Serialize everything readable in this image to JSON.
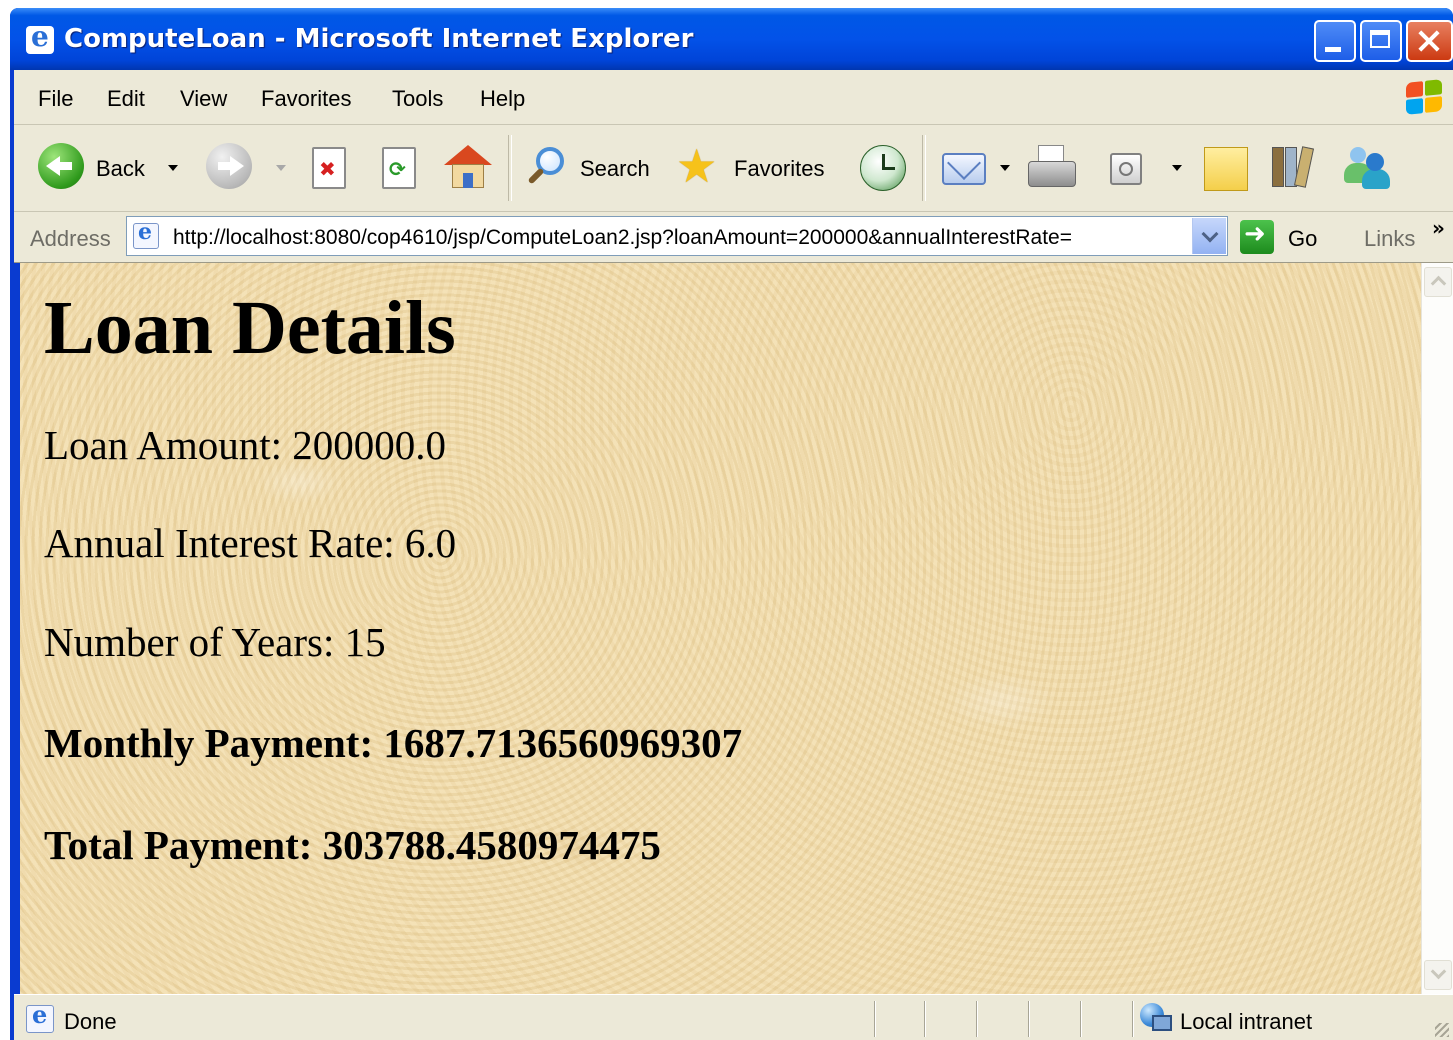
{
  "window": {
    "title": "ComputeLoan - Microsoft Internet Explorer"
  },
  "menu": {
    "file": "File",
    "edit": "Edit",
    "view": "View",
    "favorites": "Favorites",
    "tools": "Tools",
    "help": "Help"
  },
  "toolbar": {
    "back_label": "Back",
    "search_label": "Search",
    "favorites_label": "Favorites"
  },
  "address": {
    "label": "Address",
    "url": "http://localhost:8080/cop4610/jsp/ComputeLoan2.jsp?loanAmount=200000&annualInterestRate=",
    "go_label": "Go",
    "links_label": "Links",
    "overflow": "»"
  },
  "page": {
    "heading": "Loan Details",
    "loan_amount": "Loan Amount: 200000.0",
    "annual_interest_rate": "Annual Interest Rate: 6.0",
    "number_of_years": "Number of Years: 15",
    "monthly_payment": "Monthly Payment: 1687.7136560969307",
    "total_payment": "Total Payment: 303788.4580974475"
  },
  "status": {
    "text": "Done",
    "zone": "Local intranet"
  },
  "colors": {
    "titlebar": "#0054e3",
    "chrome": "#ece9d8",
    "page_background": "#f0dcae"
  }
}
